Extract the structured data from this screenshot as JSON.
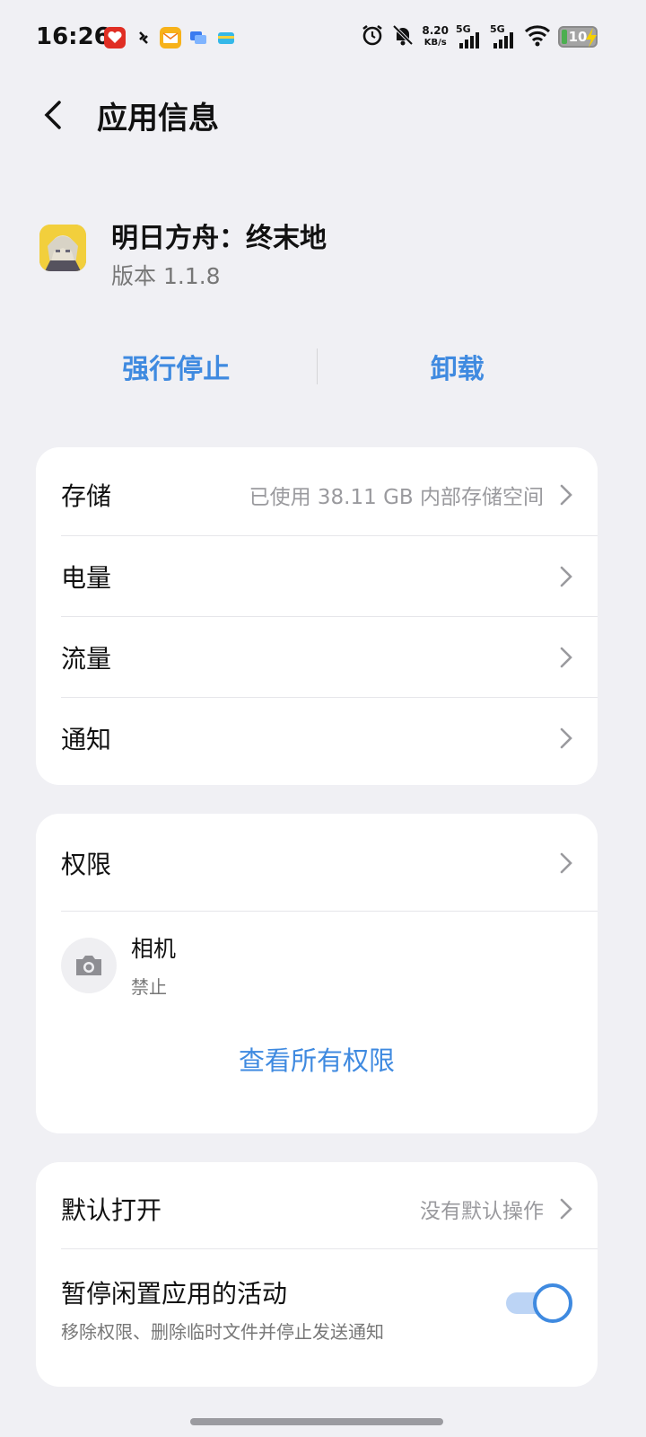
{
  "status_bar": {
    "time": "16:26",
    "net_speed_value": "8.20",
    "net_speed_unit": "KB/s",
    "sim1": "5G",
    "sim2": "5G",
    "battery": "10",
    "notification_icons": [
      "pinduoduo-icon",
      "sync-icon",
      "mail-icon",
      "chat-icon",
      "wallet-icon"
    ]
  },
  "header": {
    "title": "应用信息"
  },
  "app": {
    "name": "明日方舟：终末地",
    "version": "版本 1.1.8"
  },
  "actions": {
    "force_stop": "强行停止",
    "uninstall": "卸载"
  },
  "usage": {
    "storage": {
      "label": "存储",
      "value": "已使用 38.11 GB 内部存储空间"
    },
    "battery": {
      "label": "电量"
    },
    "data": {
      "label": "流量"
    },
    "notifications": {
      "label": "通知"
    }
  },
  "permissions": {
    "label": "权限",
    "items": [
      {
        "name": "相机",
        "state": "禁止",
        "icon": "camera-icon"
      }
    ],
    "view_all": "查看所有权限"
  },
  "defaults": {
    "open_by_default": {
      "label": "默认打开",
      "value": "没有默认操作"
    },
    "pause_app": {
      "title": "暂停闲置应用的活动",
      "subtitle": "移除权限、删除临时文件并停止发送通知",
      "enabled": true
    }
  },
  "colors": {
    "accent": "#3f8ae0",
    "background": "#f0f0f4",
    "card": "#ffffff"
  }
}
